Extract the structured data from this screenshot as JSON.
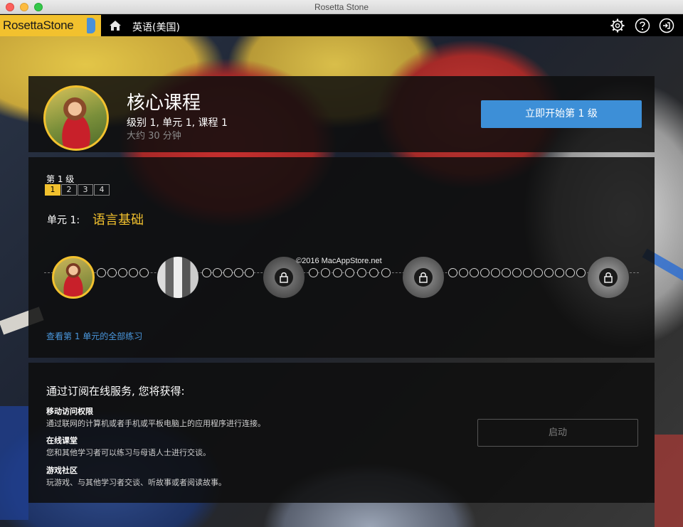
{
  "window": {
    "title": "Rosetta Stone"
  },
  "header": {
    "brand": "RosettaStone",
    "language": "英语(美国)",
    "icons": {
      "home": "home-icon",
      "settings": "gear-icon",
      "help": "help-icon",
      "exit": "exit-icon"
    }
  },
  "course": {
    "title": "核心课程",
    "subtitle": "级别 1, 单元 1, 课程 1",
    "duration": "大约 30 分钟",
    "start_button": "立即开始第 1 级"
  },
  "levels": {
    "label": "第 1 级",
    "tabs": [
      "1",
      "2",
      "3",
      "4"
    ],
    "active_index": 0
  },
  "unit": {
    "prefix": "单元 1:",
    "name": "语言基础"
  },
  "lesson_track": {
    "lessons": [
      {
        "state": "current",
        "icon": "lesson-photo"
      },
      {
        "state": "available",
        "icon": "lesson-photo"
      },
      {
        "state": "locked",
        "icon": "lock-icon"
      },
      {
        "state": "locked",
        "icon": "lock-icon"
      },
      {
        "state": "locked",
        "icon": "lock-icon"
      }
    ],
    "activity_dots_between": [
      5,
      5,
      7,
      13
    ]
  },
  "watermark": "©2016 MacAppStore.net",
  "all_exercises_link": "查看第 1 单元的全部练习",
  "subscription": {
    "title": "通过订阅在线服务, 您将获得:",
    "features": [
      {
        "heading": "移动访问权限",
        "desc": "通过联网的计算机或者手机或平板电脑上的应用程序进行连接。"
      },
      {
        "heading": "在线课堂",
        "desc": "您和其他学习者可以练习与母语人士进行交谈。"
      },
      {
        "heading": "游戏社区",
        "desc": "玩游戏、与其他学习者交谈、听故事或者阅读故事。"
      }
    ],
    "launch_button": "启动"
  },
  "colors": {
    "accent_yellow": "#f2c12e",
    "primary_blue": "#3d8fd7",
    "link_blue": "#4a98de"
  }
}
